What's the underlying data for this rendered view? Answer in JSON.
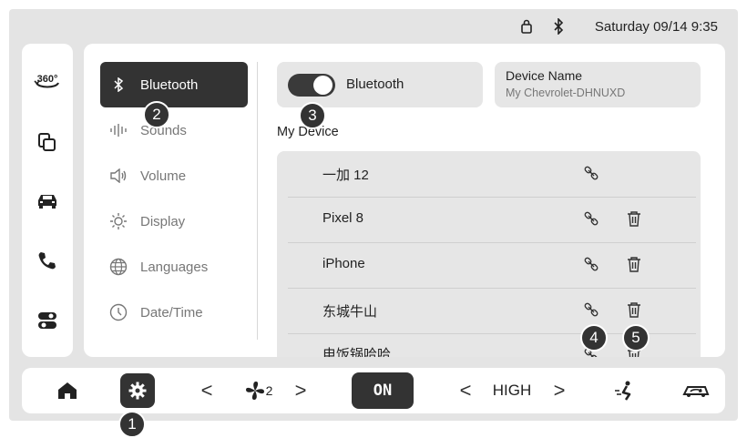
{
  "status": {
    "datetime": "Saturday 09/14 9:35",
    "icons": [
      "lock-icon",
      "bluetooth-icon"
    ]
  },
  "rail": {
    "items": [
      "camera-360-icon",
      "apps-icon",
      "car-icon",
      "phone-icon",
      "toggle-settings-icon"
    ],
    "camera_label": "360°"
  },
  "menu": [
    {
      "label": "Bluetooth",
      "icon": "bluetooth-icon",
      "active": true
    },
    {
      "label": "Sounds",
      "icon": "sound-wave-icon"
    },
    {
      "label": "Volume",
      "icon": "speaker-icon"
    },
    {
      "label": "Display",
      "icon": "brightness-icon"
    },
    {
      "label": "Languages",
      "icon": "globe-icon"
    },
    {
      "label": "Date/Time",
      "icon": "clock-icon"
    }
  ],
  "bluetooth_toggle": {
    "label": "Bluetooth",
    "on": true
  },
  "device_name": {
    "title": "Device Name",
    "value": "My Chevrolet-DHNUXD"
  },
  "my_device_label": "My Device",
  "devices": [
    {
      "name": "一加 12",
      "delete": false
    },
    {
      "name": "Pixel 8",
      "delete": true
    },
    {
      "name": "iPhone",
      "delete": true
    },
    {
      "name": "东城牛山",
      "delete": true
    },
    {
      "name": "电饭锅哈哈",
      "delete": true
    }
  ],
  "bottom": {
    "fan_speed": "2",
    "ac_label": "ON",
    "fan_level": "HIGH",
    "prev": "<",
    "next": ">"
  },
  "callouts": [
    "1",
    "2",
    "3",
    "4",
    "5"
  ],
  "colors": {
    "accent": "#333333",
    "panel": "#ffffff",
    "background": "#e4e4e4"
  }
}
